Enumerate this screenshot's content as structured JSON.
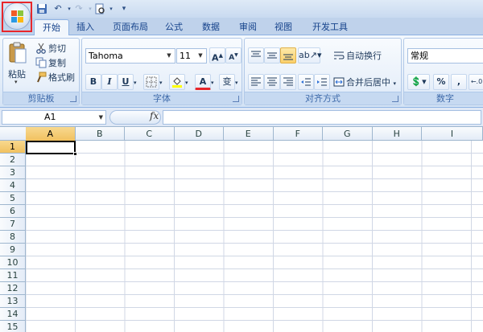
{
  "quick_access": {
    "save_icon": "save-icon",
    "undo_icon": "undo-icon",
    "redo_icon": "redo-icon",
    "preview_icon": "print-preview-icon",
    "more": "▾"
  },
  "tabs": [
    {
      "label": "开始",
      "active": true
    },
    {
      "label": "插入"
    },
    {
      "label": "页面布局"
    },
    {
      "label": "公式"
    },
    {
      "label": "数据"
    },
    {
      "label": "审阅"
    },
    {
      "label": "视图"
    },
    {
      "label": "开发工具"
    }
  ],
  "clipboard": {
    "paste": "粘贴",
    "cut": "剪切",
    "copy": "复制",
    "format_painter": "格式刷",
    "label": "剪贴板"
  },
  "font": {
    "name": "Tahoma",
    "size": "11",
    "grow": "A",
    "shrink": "A",
    "bold": "B",
    "italic": "I",
    "underline": "U",
    "color_letter": "A",
    "phonetic": "变",
    "label": "字体"
  },
  "alignment": {
    "wrap": "自动换行",
    "merge": "合并后居中",
    "label": "对齐方式"
  },
  "number": {
    "format": "常规",
    "percent": "%",
    "comma": ",",
    "label": "数字"
  },
  "formula_bar": {
    "name_box": "A1",
    "fx": "fx",
    "formula": ""
  },
  "columns": [
    "A",
    "B",
    "C",
    "D",
    "E",
    "F",
    "G",
    "H",
    "I"
  ],
  "rows": [
    "1",
    "2",
    "3",
    "4",
    "5",
    "6",
    "7",
    "8",
    "9",
    "10",
    "11",
    "12",
    "13",
    "14",
    "15"
  ],
  "colors": {
    "accent": "#e8262b",
    "selected_header": "#f1c15f",
    "grid_line": "#d0d7e5"
  }
}
